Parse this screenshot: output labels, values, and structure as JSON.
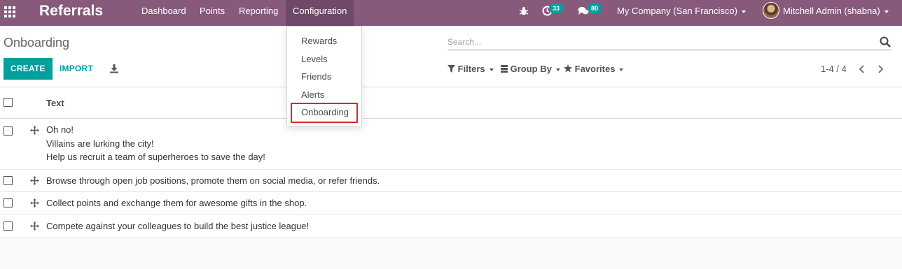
{
  "navbar": {
    "brand": "Referrals",
    "menu": [
      {
        "label": "Dashboard"
      },
      {
        "label": "Points"
      },
      {
        "label": "Reporting"
      },
      {
        "label": "Configuration"
      }
    ],
    "activity_count": "33",
    "messages_count": "80",
    "company": "My Company (San Francisco)",
    "user": "Mitchell Admin (shabna)",
    "colors": {
      "primary": "#875a7b",
      "accent": "#00a09d"
    }
  },
  "config_menu": {
    "items": [
      "Rewards",
      "Levels",
      "Friends",
      "Alerts",
      "Onboarding"
    ],
    "highlighted": "Onboarding"
  },
  "control_panel": {
    "breadcrumb": "Onboarding",
    "create_label": "CREATE",
    "import_label": "IMPORT",
    "search_placeholder": "Search...",
    "filters_label": "Filters",
    "group_by_label": "Group By",
    "favorites_label": "Favorites",
    "pager": "1-4 / 4"
  },
  "list": {
    "column_header": "Text",
    "rows": [
      {
        "lines": [
          "Oh no!",
          "Villains are lurking the city!",
          "Help us recruit a team of superheroes to save the day!"
        ]
      },
      {
        "lines": [
          "Browse through open job positions, promote them on social media, or refer friends."
        ]
      },
      {
        "lines": [
          "Collect points and exchange them for awesome gifts in the shop."
        ]
      },
      {
        "lines": [
          "Compete against your colleagues to build the best justice league!"
        ]
      }
    ]
  },
  "icons": {
    "apps": "grid-icon",
    "bug": "bug-icon",
    "activity": "clock-icon",
    "messages": "chat-icon",
    "download": "download-icon",
    "search": "search-icon",
    "filter": "filter-icon",
    "favorites": "star-icon",
    "drag": "move-icon"
  }
}
